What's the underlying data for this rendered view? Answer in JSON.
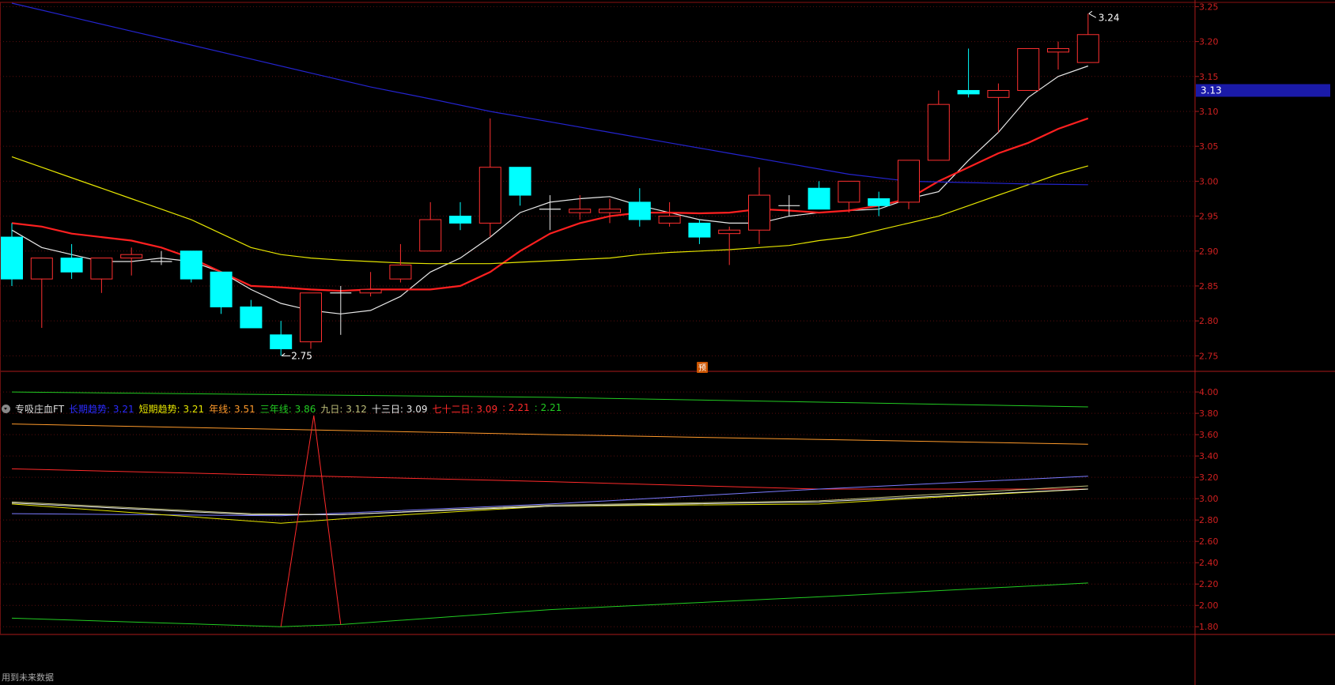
{
  "main_chart": {
    "chart_data": {
      "type": "candlestick",
      "y_ticks": [
        "3.25",
        "3.20",
        "3.15",
        "3.10",
        "3.05",
        "3.00",
        "2.95",
        "2.90",
        "2.85",
        "2.80",
        "2.75"
      ],
      "ylim": [
        2.73,
        3.255
      ],
      "current_price_tag": "3.13",
      "high_label": "3.24",
      "low_label": "2.75",
      "forecast_badge": "预",
      "candles": [
        {
          "o": 2.92,
          "c": 2.86,
          "h": 2.94,
          "l": 2.85
        },
        {
          "o": 2.86,
          "c": 2.89,
          "h": 2.89,
          "l": 2.79
        },
        {
          "o": 2.89,
          "c": 2.87,
          "h": 2.91,
          "l": 2.86
        },
        {
          "o": 2.86,
          "c": 2.89,
          "h": 2.89,
          "l": 2.84
        },
        {
          "o": 2.89,
          "c": 2.895,
          "h": 2.905,
          "l": 2.865
        },
        {
          "o": 2.885,
          "c": 2.885,
          "h": 2.9,
          "l": 2.88
        },
        {
          "o": 2.9,
          "c": 2.86,
          "h": 2.9,
          "l": 2.855
        },
        {
          "o": 2.87,
          "c": 2.82,
          "h": 2.87,
          "l": 2.81
        },
        {
          "o": 2.82,
          "c": 2.79,
          "h": 2.83,
          "l": 2.79
        },
        {
          "o": 2.78,
          "c": 2.76,
          "h": 2.8,
          "l": 2.75
        },
        {
          "o": 2.77,
          "c": 2.84,
          "h": 2.84,
          "l": 2.76
        },
        {
          "o": 2.84,
          "c": 2.84,
          "h": 2.85,
          "l": 2.78
        },
        {
          "o": 2.84,
          "c": 2.845,
          "h": 2.87,
          "l": 2.835
        },
        {
          "o": 2.86,
          "c": 2.88,
          "h": 2.91,
          "l": 2.855
        },
        {
          "o": 2.9,
          "c": 2.945,
          "h": 2.97,
          "l": 2.9
        },
        {
          "o": 2.95,
          "c": 2.94,
          "h": 2.97,
          "l": 2.93
        },
        {
          "o": 2.94,
          "c": 3.02,
          "h": 3.09,
          "l": 2.92
        },
        {
          "o": 3.02,
          "c": 2.98,
          "h": 3.02,
          "l": 2.965
        },
        {
          "o": 2.96,
          "c": 2.96,
          "h": 2.98,
          "l": 2.93
        },
        {
          "o": 2.955,
          "c": 2.96,
          "h": 2.98,
          "l": 2.945
        },
        {
          "o": 2.955,
          "c": 2.96,
          "h": 2.975,
          "l": 2.94
        },
        {
          "o": 2.97,
          "c": 2.945,
          "h": 2.99,
          "l": 2.935
        },
        {
          "o": 2.94,
          "c": 2.95,
          "h": 2.97,
          "l": 2.935
        },
        {
          "o": 2.94,
          "c": 2.92,
          "h": 2.945,
          "l": 2.91
        },
        {
          "o": 2.925,
          "c": 2.93,
          "h": 2.935,
          "l": 2.88
        },
        {
          "o": 2.93,
          "c": 2.98,
          "h": 3.02,
          "l": 2.91
        },
        {
          "o": 2.965,
          "c": 2.965,
          "h": 2.98,
          "l": 2.95
        },
        {
          "o": 2.99,
          "c": 2.96,
          "h": 3.0,
          "l": 2.96
        },
        {
          "o": 2.97,
          "c": 3.0,
          "h": 3.0,
          "l": 2.955
        },
        {
          "o": 2.975,
          "c": 2.965,
          "h": 2.985,
          "l": 2.95
        },
        {
          "o": 2.97,
          "c": 3.03,
          "h": 3.03,
          "l": 2.96
        },
        {
          "o": 3.03,
          "c": 3.11,
          "h": 3.13,
          "l": 3.03
        },
        {
          "o": 3.13,
          "c": 3.125,
          "h": 3.19,
          "l": 3.12
        },
        {
          "o": 3.12,
          "c": 3.13,
          "h": 3.14,
          "l": 3.07
        },
        {
          "o": 3.13,
          "c": 3.19,
          "h": 3.19,
          "l": 3.13
        },
        {
          "o": 3.185,
          "c": 3.19,
          "h": 3.2,
          "l": 3.16
        },
        {
          "o": 3.17,
          "c": 3.21,
          "h": 3.24,
          "l": 3.17
        }
      ],
      "lines": [
        {
          "name": "ma_white",
          "color": "#e8e8e8",
          "points": [
            [
              0,
              2.93
            ],
            [
              1,
              2.905
            ],
            [
              2,
              2.895
            ],
            [
              3,
              2.885
            ],
            [
              4,
              2.885
            ],
            [
              5,
              2.89
            ],
            [
              6,
              2.885
            ],
            [
              7,
              2.87
            ],
            [
              8,
              2.845
            ],
            [
              9,
              2.825
            ],
            [
              10,
              2.815
            ],
            [
              11,
              2.81
            ],
            [
              12,
              2.815
            ],
            [
              13,
              2.835
            ],
            [
              14,
              2.87
            ],
            [
              15,
              2.89
            ],
            [
              16,
              2.92
            ],
            [
              17,
              2.955
            ],
            [
              18,
              2.97
            ],
            [
              19,
              2.975
            ],
            [
              20,
              2.978
            ],
            [
              21,
              2.965
            ],
            [
              22,
              2.955
            ],
            [
              23,
              2.945
            ],
            [
              24,
              2.94
            ],
            [
              25,
              2.94
            ],
            [
              26,
              2.95
            ],
            [
              27,
              2.955
            ],
            [
              28,
              2.958
            ],
            [
              29,
              2.96
            ],
            [
              30,
              2.975
            ],
            [
              31,
              2.985
            ],
            [
              32,
              3.03
            ],
            [
              33,
              3.07
            ],
            [
              34,
              3.12
            ],
            [
              35,
              3.15
            ],
            [
              36,
              3.165
            ]
          ]
        },
        {
          "name": "ma_red",
          "color": "#ff2020",
          "points": [
            [
              0,
              2.94
            ],
            [
              1,
              2.935
            ],
            [
              2,
              2.925
            ],
            [
              3,
              2.92
            ],
            [
              4,
              2.915
            ],
            [
              5,
              2.905
            ],
            [
              6,
              2.89
            ],
            [
              7,
              2.87
            ],
            [
              8,
              2.85
            ],
            [
              9,
              2.848
            ],
            [
              10,
              2.845
            ],
            [
              11,
              2.843
            ],
            [
              12,
              2.845
            ],
            [
              13,
              2.845
            ],
            [
              14,
              2.845
            ],
            [
              15,
              2.85
            ],
            [
              16,
              2.87
            ],
            [
              17,
              2.9
            ],
            [
              18,
              2.925
            ],
            [
              19,
              2.94
            ],
            [
              20,
              2.95
            ],
            [
              21,
              2.955
            ],
            [
              22,
              2.955
            ],
            [
              23,
              2.954
            ],
            [
              24,
              2.955
            ],
            [
              25,
              2.96
            ],
            [
              26,
              2.958
            ],
            [
              27,
              2.955
            ],
            [
              28,
              2.958
            ],
            [
              29,
              2.965
            ],
            [
              30,
              2.975
            ],
            [
              31,
              3.0
            ],
            [
              32,
              3.02
            ],
            [
              33,
              3.04
            ],
            [
              34,
              3.055
            ],
            [
              35,
              3.075
            ],
            [
              36,
              3.09
            ]
          ]
        },
        {
          "name": "ma_yellow",
          "color": "#e6e600",
          "points": [
            [
              0,
              3.035
            ],
            [
              1,
              3.02
            ],
            [
              2,
              3.005
            ],
            [
              3,
              2.99
            ],
            [
              4,
              2.975
            ],
            [
              5,
              2.96
            ],
            [
              6,
              2.945
            ],
            [
              7,
              2.925
            ],
            [
              8,
              2.905
            ],
            [
              9,
              2.895
            ],
            [
              10,
              2.89
            ],
            [
              11,
              2.887
            ],
            [
              12,
              2.885
            ],
            [
              13,
              2.883
            ],
            [
              14,
              2.882
            ],
            [
              15,
              2.882
            ],
            [
              16,
              2.882
            ],
            [
              17,
              2.884
            ],
            [
              18,
              2.886
            ],
            [
              19,
              2.888
            ],
            [
              20,
              2.89
            ],
            [
              21,
              2.895
            ],
            [
              22,
              2.898
            ],
            [
              23,
              2.9
            ],
            [
              24,
              2.902
            ],
            [
              25,
              2.905
            ],
            [
              26,
              2.908
            ],
            [
              27,
              2.915
            ],
            [
              28,
              2.92
            ],
            [
              29,
              2.93
            ],
            [
              30,
              2.94
            ],
            [
              31,
              2.95
            ],
            [
              32,
              2.965
            ],
            [
              33,
              2.98
            ],
            [
              34,
              2.995
            ],
            [
              35,
              3.01
            ],
            [
              36,
              3.022
            ]
          ]
        },
        {
          "name": "ma_blue",
          "color": "#2424d0",
          "points": [
            [
              0,
              3.255
            ],
            [
              2,
              3.235
            ],
            [
              4,
              3.215
            ],
            [
              6,
              3.195
            ],
            [
              8,
              3.175
            ],
            [
              10,
              3.155
            ],
            [
              12,
              3.135
            ],
            [
              14,
              3.118
            ],
            [
              16,
              3.1
            ],
            [
              18,
              3.085
            ],
            [
              20,
              3.07
            ],
            [
              22,
              3.055
            ],
            [
              24,
              3.04
            ],
            [
              26,
              3.025
            ],
            [
              28,
              3.01
            ],
            [
              30,
              3.0
            ],
            [
              32,
              2.998
            ],
            [
              34,
              2.996
            ],
            [
              36,
              2.995
            ]
          ]
        }
      ]
    }
  },
  "indicator": {
    "name": "专吸庄血FT",
    "legend": [
      {
        "text": "长期趋势: 3.21",
        "color": "#2b2bff"
      },
      {
        "text": "短期趋势: 3.21",
        "color": "#e6e600"
      },
      {
        "text": "年线: 3.51",
        "color": "#ff9a2b"
      },
      {
        "text": "三年线: 3.86",
        "color": "#22cc22"
      },
      {
        "text": "九日: 3.12",
        "color": "#bfbf7a"
      },
      {
        "text": "十三日: 3.09",
        "color": "#e8e8e8"
      },
      {
        "text": "七十二日: 3.09",
        "color": "#ff2a2a"
      },
      {
        "text": ": 2.21",
        "color": "#ff2a2a"
      },
      {
        "text": ": 2.21",
        "color": "#22cc22"
      }
    ],
    "chart_data": {
      "type": "line",
      "y_ticks": [
        "4.00",
        "3.80",
        "3.60",
        "3.40",
        "3.20",
        "3.00",
        "2.80",
        "2.60",
        "2.40",
        "2.20",
        "2.00",
        "1.80"
      ],
      "ylim": [
        1.75,
        4.06
      ],
      "series": [
        {
          "name": "三年线",
          "color": "#22cc22",
          "points": [
            [
              0,
              4.0
            ],
            [
              18,
              3.95
            ],
            [
              36,
              3.86
            ]
          ]
        },
        {
          "name": "年线",
          "color": "#ff9a2b",
          "points": [
            [
              0,
              3.7
            ],
            [
              18,
              3.6
            ],
            [
              36,
              3.51
            ]
          ]
        },
        {
          "name": "七十二日",
          "color": "#ff2a2a",
          "points": [
            [
              0,
              3.28
            ],
            [
              18,
              3.16
            ],
            [
              27,
              3.09
            ],
            [
              36,
              3.09
            ]
          ]
        },
        {
          "name": "长期趋势",
          "color": "#7b7bff",
          "points": [
            [
              0,
              2.86
            ],
            [
              9,
              2.84
            ],
            [
              18,
              2.95
            ],
            [
              27,
              3.09
            ],
            [
              36,
              3.21
            ]
          ]
        },
        {
          "name": "短期趋势",
          "color": "#e6e600",
          "points": [
            [
              0,
              2.95
            ],
            [
              9,
              2.77
            ],
            [
              12,
              2.83
            ],
            [
              18,
              2.93
            ],
            [
              27,
              2.95
            ],
            [
              30,
              3.0
            ],
            [
              36,
              3.09
            ]
          ]
        },
        {
          "name": "九日",
          "color": "#bfbf7a",
          "points": [
            [
              0,
              2.97
            ],
            [
              8,
              2.86
            ],
            [
              11,
              2.85
            ],
            [
              18,
              2.94
            ],
            [
              27,
              2.98
            ],
            [
              36,
              3.12
            ]
          ]
        },
        {
          "name": "十三日",
          "color": "#e8e8e8",
          "points": [
            [
              0,
              2.96
            ],
            [
              8,
              2.85
            ],
            [
              11,
              2.85
            ],
            [
              18,
              2.93
            ],
            [
              27,
              2.97
            ],
            [
              36,
              3.09
            ]
          ]
        },
        {
          "name": "bottom_green",
          "color": "#22cc22",
          "points": [
            [
              0,
              1.88
            ],
            [
              9,
              1.8
            ],
            [
              11,
              1.82
            ],
            [
              18,
              1.96
            ],
            [
              27,
              2.08
            ],
            [
              36,
              2.21
            ]
          ]
        },
        {
          "name": "spike_red",
          "color": "#ff2a2a",
          "points": [
            [
              9,
              1.8
            ],
            [
              10.1,
              3.78
            ],
            [
              11,
              1.82
            ]
          ]
        }
      ]
    }
  },
  "footer": {
    "text": "用到未来数据"
  }
}
